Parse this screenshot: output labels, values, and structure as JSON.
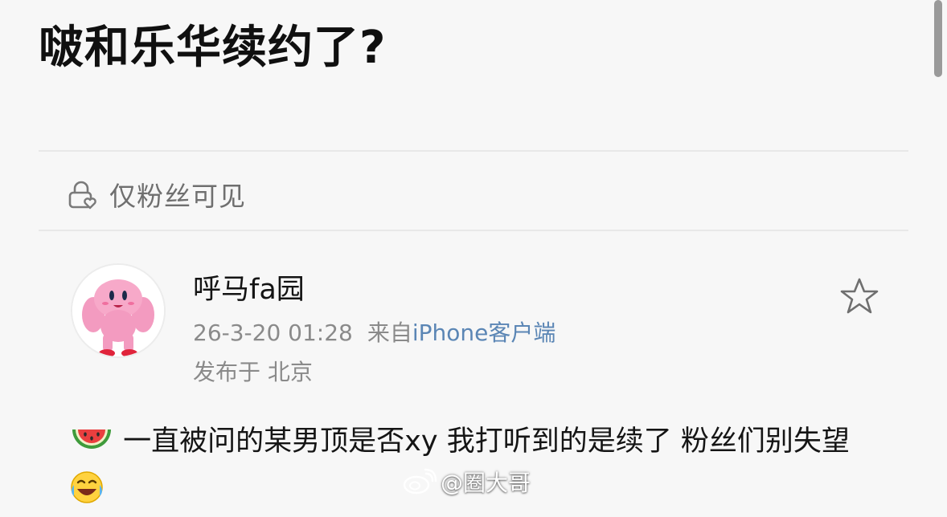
{
  "header": {
    "title": "啵和乐华续约了?"
  },
  "visibility": {
    "icon": "lock-heart-icon",
    "label": "仅粉丝可见"
  },
  "post": {
    "avatar_icon": "pink-muscle-avatar-icon",
    "username": "呼马fa园",
    "datetime": "26-3-20 01:28",
    "source_prefix": "来自",
    "source_client": "iPhone客户端",
    "location": "发布于 北京",
    "favorite_icon": "star-outline-icon",
    "content_icon": "watermelon-icon",
    "content_part1": "一直被问的某男顶是否xy 我打听到的是续了 粉丝们别失望",
    "content_end_icon": "laugh-cry-emoji-icon"
  },
  "watermark": {
    "icon": "weibo-logo-icon",
    "text": "@圈大哥"
  },
  "colors": {
    "background": "#f7f7f7",
    "title": "#101010",
    "meta": "#8a8a8a",
    "client_link": "#5b86b5",
    "avatar_pink": "#f39bc0"
  }
}
